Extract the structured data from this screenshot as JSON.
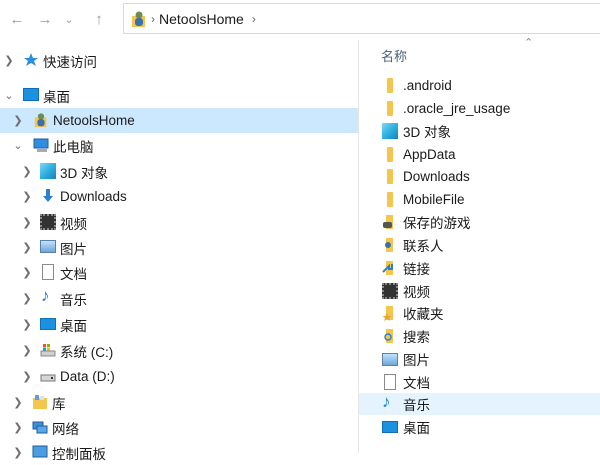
{
  "address": {
    "path": "NetoolsHome"
  },
  "nav": {
    "items": [
      {
        "label": "快速访问",
        "icon": "star-icon"
      },
      {
        "label": "桌面",
        "icon": "desktop-icon"
      },
      {
        "label": "NetoolsHome",
        "icon": "user-folder-icon",
        "selected": true
      },
      {
        "label": "此电脑",
        "icon": "computer-icon"
      },
      {
        "label": "3D 对象",
        "icon": "3d-objects-icon"
      },
      {
        "label": "Downloads",
        "icon": "download-arrow-icon"
      },
      {
        "label": "视频",
        "icon": "video-icon"
      },
      {
        "label": "图片",
        "icon": "picture-icon"
      },
      {
        "label": "文档",
        "icon": "document-icon"
      },
      {
        "label": "音乐",
        "icon": "music-note-icon"
      },
      {
        "label": "桌面",
        "icon": "desktop-icon"
      },
      {
        "label": "系统 (C:)",
        "icon": "drive-c-icon"
      },
      {
        "label": "Data (D:)",
        "icon": "drive-d-icon"
      },
      {
        "label": "库",
        "icon": "library-icon"
      },
      {
        "label": "网络",
        "icon": "network-icon"
      },
      {
        "label": "控制面板",
        "icon": "control-panel-icon"
      }
    ]
  },
  "content": {
    "column_header": "名称",
    "files": [
      {
        "label": ".android",
        "icon": "folder-icon"
      },
      {
        "label": ".oracle_jre_usage",
        "icon": "folder-icon"
      },
      {
        "label": "3D 对象",
        "icon": "3d-objects-icon"
      },
      {
        "label": "AppData",
        "icon": "folder-icon"
      },
      {
        "label": "Downloads",
        "icon": "folder-icon"
      },
      {
        "label": "MobileFile",
        "icon": "folder-icon"
      },
      {
        "label": "保存的游戏",
        "icon": "saved-games-icon"
      },
      {
        "label": "联系人",
        "icon": "contacts-icon"
      },
      {
        "label": "链接",
        "icon": "links-icon"
      },
      {
        "label": "视频",
        "icon": "video-icon"
      },
      {
        "label": "收藏夹",
        "icon": "favorites-icon"
      },
      {
        "label": "搜索",
        "icon": "searches-icon"
      },
      {
        "label": "图片",
        "icon": "picture-icon"
      },
      {
        "label": "文档",
        "icon": "document-icon"
      },
      {
        "label": "音乐",
        "icon": "music-note-icon",
        "hovered": true
      },
      {
        "label": "桌面",
        "icon": "desktop-icon"
      }
    ]
  }
}
